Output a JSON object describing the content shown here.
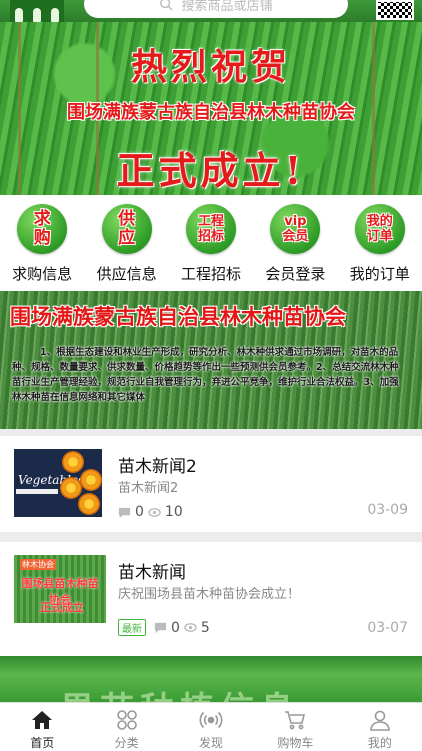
{
  "header": {
    "search_placeholder": "搜索商品或店铺"
  },
  "banner_top": {
    "line1": "热烈祝贺",
    "line2": "围场满族蒙古族自治县林木种苗协会",
    "line3": "正式成立!"
  },
  "quick_links": [
    {
      "icon_text": "求\n购",
      "label": "求购信息"
    },
    {
      "icon_text": "供\n应",
      "label": "供应信息"
    },
    {
      "icon_text": "工程\n招标",
      "label": "工程招标"
    },
    {
      "icon_text": "vip\n会员",
      "label": "会员登录"
    },
    {
      "icon_text": "我的\n订单",
      "label": "我的订单"
    }
  ],
  "banner_intro": {
    "title": "围场满族蒙古族自治县林木种苗协会",
    "text": "1、根据生态建设和林业生产形成，研究分析、林木种供求通过市场调研，对苗木的品种、规格、数量要求、供求数量、价格趋势等作出一些预测供会员参考。2、总结交流林木种苗行业生产管理经验，规范行业自我管理行为，弃进公平竞争，维护行业合法权益。3、加强林木种苗在信息网络和其它媒体"
  },
  "news": [
    {
      "title": "苗木新闻2",
      "summary": "苗木新闻2",
      "badge": "",
      "comments": "0",
      "views": "10",
      "date": "03-09",
      "thumb_text": "Vegetables"
    },
    {
      "title": "苗木新闻",
      "summary": "庆祝围场县苗木种苗协会成立！",
      "badge": "最新",
      "comments": "0",
      "views": "5",
      "date": "03-07",
      "thumb_text_a": "林木协会",
      "thumb_text_b": "围场县苗木种苗协会",
      "thumb_text_c": "正式成立"
    }
  ],
  "banner_bottom": {
    "text": "果苗种植信息"
  },
  "tabbar": [
    {
      "label": "首页",
      "icon": "home-icon",
      "active": true
    },
    {
      "label": "分类",
      "icon": "grid-icon",
      "active": false
    },
    {
      "label": "发现",
      "icon": "broadcast-icon",
      "active": false
    },
    {
      "label": "购物车",
      "icon": "cart-icon",
      "active": false
    },
    {
      "label": "我的",
      "icon": "user-icon",
      "active": false
    }
  ],
  "colors": {
    "brand_green": "#2c7d2b",
    "accent_red": "#e51b1b",
    "badge_green": "#41b53c"
  }
}
